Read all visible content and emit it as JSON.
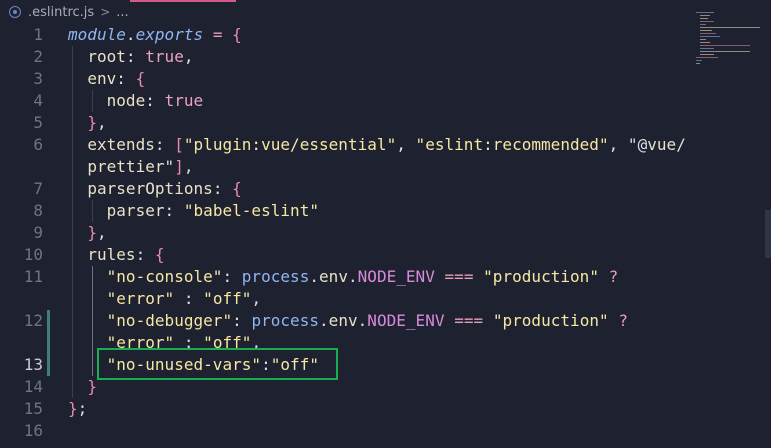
{
  "breadcrumb": {
    "file": ".eslintrc.js",
    "separator": ">",
    "more": "..."
  },
  "colors": {
    "background": "#1e2130",
    "highlight_box": "#1aad4f",
    "tab_accent": "#d45a8a",
    "modified_marker": "#3f7f7a"
  },
  "lines": [
    {
      "n": "1",
      "text": "module.exports = {"
    },
    {
      "n": "2",
      "text": "  root: true,"
    },
    {
      "n": "3",
      "text": "  env: {"
    },
    {
      "n": "4",
      "text": "    node: true"
    },
    {
      "n": "5",
      "text": "  },"
    },
    {
      "n": "6",
      "text": "  extends: [\"plugin:vue/essential\", \"eslint:recommended\", \"@vue/"
    },
    {
      "n": "",
      "text": "  prettier\"],"
    },
    {
      "n": "7",
      "text": "  parserOptions: {"
    },
    {
      "n": "8",
      "text": "    parser: \"babel-eslint\""
    },
    {
      "n": "9",
      "text": "  },"
    },
    {
      "n": "10",
      "text": "  rules: {"
    },
    {
      "n": "11",
      "text": "    \"no-console\": process.env.NODE_ENV === \"production\" ?"
    },
    {
      "n": "",
      "text": "    \"error\" : \"off\","
    },
    {
      "n": "12",
      "text": "    \"no-debugger\": process.env.NODE_ENV === \"production\" ?"
    },
    {
      "n": "",
      "text": "    \"error\" : \"off\","
    },
    {
      "n": "13",
      "text": "    \"no-unused-vars\":\"off\""
    },
    {
      "n": "14",
      "text": "  }"
    },
    {
      "n": "15",
      "text": "};"
    },
    {
      "n": "16",
      "text": ""
    }
  ]
}
